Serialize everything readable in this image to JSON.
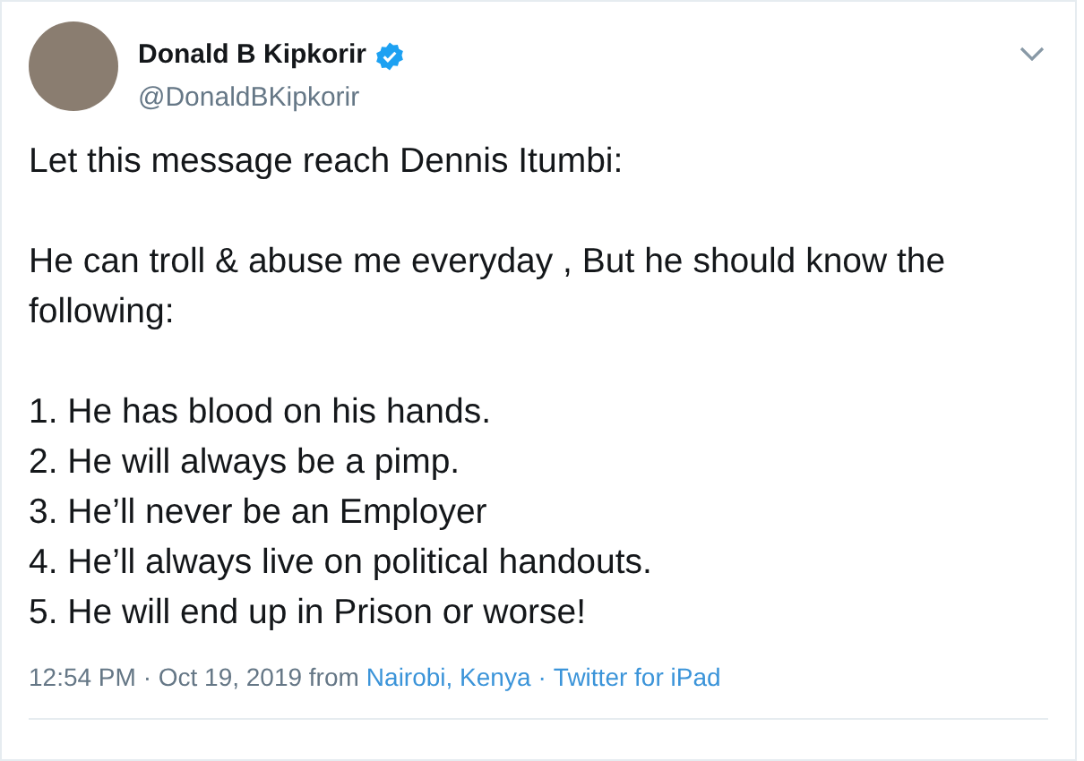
{
  "author": {
    "name": "Donald B Kipkorir",
    "verified": true,
    "handle": "@DonaldBKipkorir"
  },
  "paragraphs": [
    "Let this message reach Dennis Itumbi:",
    "He can troll & abuse me everyday , But he should know the following:"
  ],
  "list_items": [
    "1. He has blood on his hands.",
    "2. He will always be a pimp.",
    "3. He’ll never be an Employer",
    "4. He’ll always live on political handouts.",
    "5. He will end up in Prison or worse!"
  ],
  "footer": {
    "timestamp": "12:54 PM · Oct 19, 2019 from",
    "location": "Nairobi, Kenya",
    "separator": "·",
    "source": "Twitter for iPad"
  }
}
